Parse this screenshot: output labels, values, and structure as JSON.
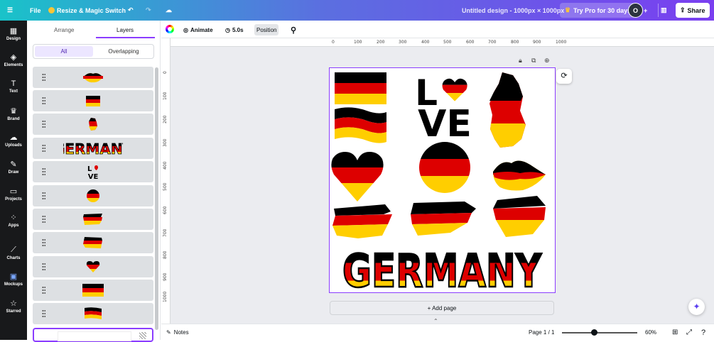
{
  "topbar": {
    "menu_icon": "hamburger-icon",
    "file": "File",
    "resize": "Resize & Magic Switch",
    "doc_title": "Untitled design - 1000px × 1000px",
    "try_pro": "Try Pro for 30 days",
    "avatar_initial": "O",
    "share": "Share"
  },
  "rail": [
    {
      "label": "Design",
      "icon": "layout-icon",
      "glyph": "▦"
    },
    {
      "label": "Elements",
      "icon": "shapes-icon",
      "glyph": "◈"
    },
    {
      "label": "Text",
      "icon": "text-icon",
      "glyph": "T"
    },
    {
      "label": "Brand",
      "icon": "brand-icon",
      "glyph": "♛"
    },
    {
      "label": "Uploads",
      "icon": "cloud-upload-icon",
      "glyph": "☁"
    },
    {
      "label": "Draw",
      "icon": "pen-icon",
      "glyph": "✎"
    },
    {
      "label": "Projects",
      "icon": "folder-icon",
      "glyph": "▭"
    },
    {
      "label": "Apps",
      "icon": "apps-grid-icon",
      "glyph": "⁘"
    },
    {
      "label": "Charts",
      "icon": "chart-icon",
      "glyph": "⟋"
    },
    {
      "label": "Mockups",
      "icon": "mockups-icon",
      "glyph": "▣"
    },
    {
      "label": "Starred",
      "icon": "star-icon",
      "glyph": "☆"
    }
  ],
  "panel": {
    "tab_arrange": "Arrange",
    "tab_layers": "Layers",
    "filter_all": "All",
    "filter_overlapping": "Overlapping",
    "layers": [
      "lips-flag",
      "brush-flag-small",
      "germany-map",
      "germany-text",
      "love-text",
      "circle-flag",
      "brush-flag-1",
      "brush-flag-2",
      "heart-flag",
      "rect-flag",
      "wave-flag"
    ]
  },
  "toolbar": {
    "animate": "Animate",
    "duration": "5.0s",
    "position": "Position"
  },
  "rulers": {
    "top": [
      "0",
      "100",
      "200",
      "300",
      "400",
      "500",
      "600",
      "700",
      "800",
      "900",
      "1000"
    ],
    "left": [
      "0",
      "100",
      "200",
      "300",
      "400",
      "500",
      "600",
      "700",
      "800",
      "900",
      "1000"
    ]
  },
  "canvas": {
    "love_l": "L",
    "love_ve": "VE",
    "germany_text": "GERMANY",
    "colors": {
      "black": "#000000",
      "red": "#dd0000",
      "gold": "#ffce00"
    }
  },
  "add_page": "+ Add page",
  "bottom": {
    "notes": "Notes",
    "page": "Page 1 / 1",
    "zoom": "60%",
    "zoom_fraction": 0.42
  }
}
